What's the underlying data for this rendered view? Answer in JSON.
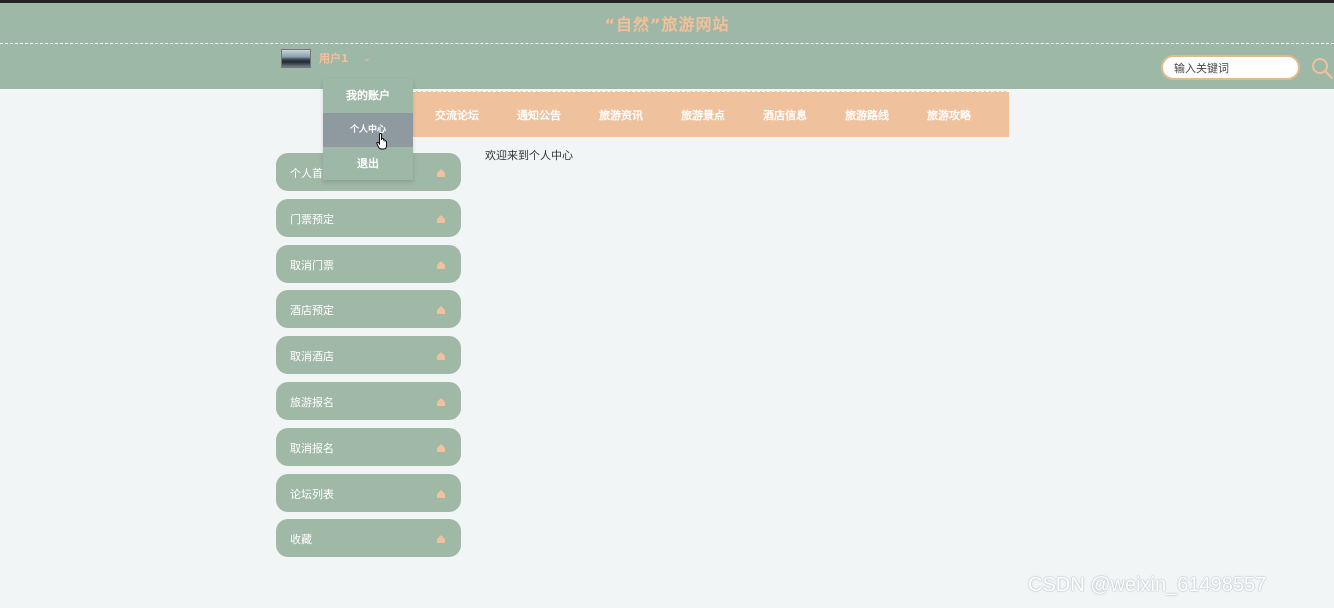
{
  "header": {
    "site_title": "“自然”旅游网站",
    "user_name": "用户1",
    "caret": "⌄",
    "search_placeholder": "输入关键词"
  },
  "nav": {
    "items": [
      "交流论坛",
      "通知公告",
      "旅游资讯",
      "旅游景点",
      "酒店信息",
      "旅游路线",
      "旅游攻略"
    ]
  },
  "dropdown": {
    "items": [
      "我的账户",
      "个人中心",
      "退出"
    ],
    "active_index": 1
  },
  "sidebar": {
    "items": [
      "个人首页",
      "门票预定",
      "取消门票",
      "酒店预定",
      "取消酒店",
      "旅游报名",
      "取消报名",
      "论坛列表",
      "收藏"
    ]
  },
  "content": {
    "welcome_text": "欢迎来到个人中心"
  },
  "watermark": "CSDN @weixin_61498557",
  "colors": {
    "header_bg": "#9db8a6",
    "accent": "#f0c19d",
    "title_color": "#f3c09a",
    "sidebar_bg": "#a0b8a6",
    "dropdown_active": "#8e9aa0"
  },
  "icons": {
    "search": "search-icon",
    "avatar": "avatar",
    "sidebar_item": "home-icon",
    "cursor": "hand-cursor-icon"
  }
}
